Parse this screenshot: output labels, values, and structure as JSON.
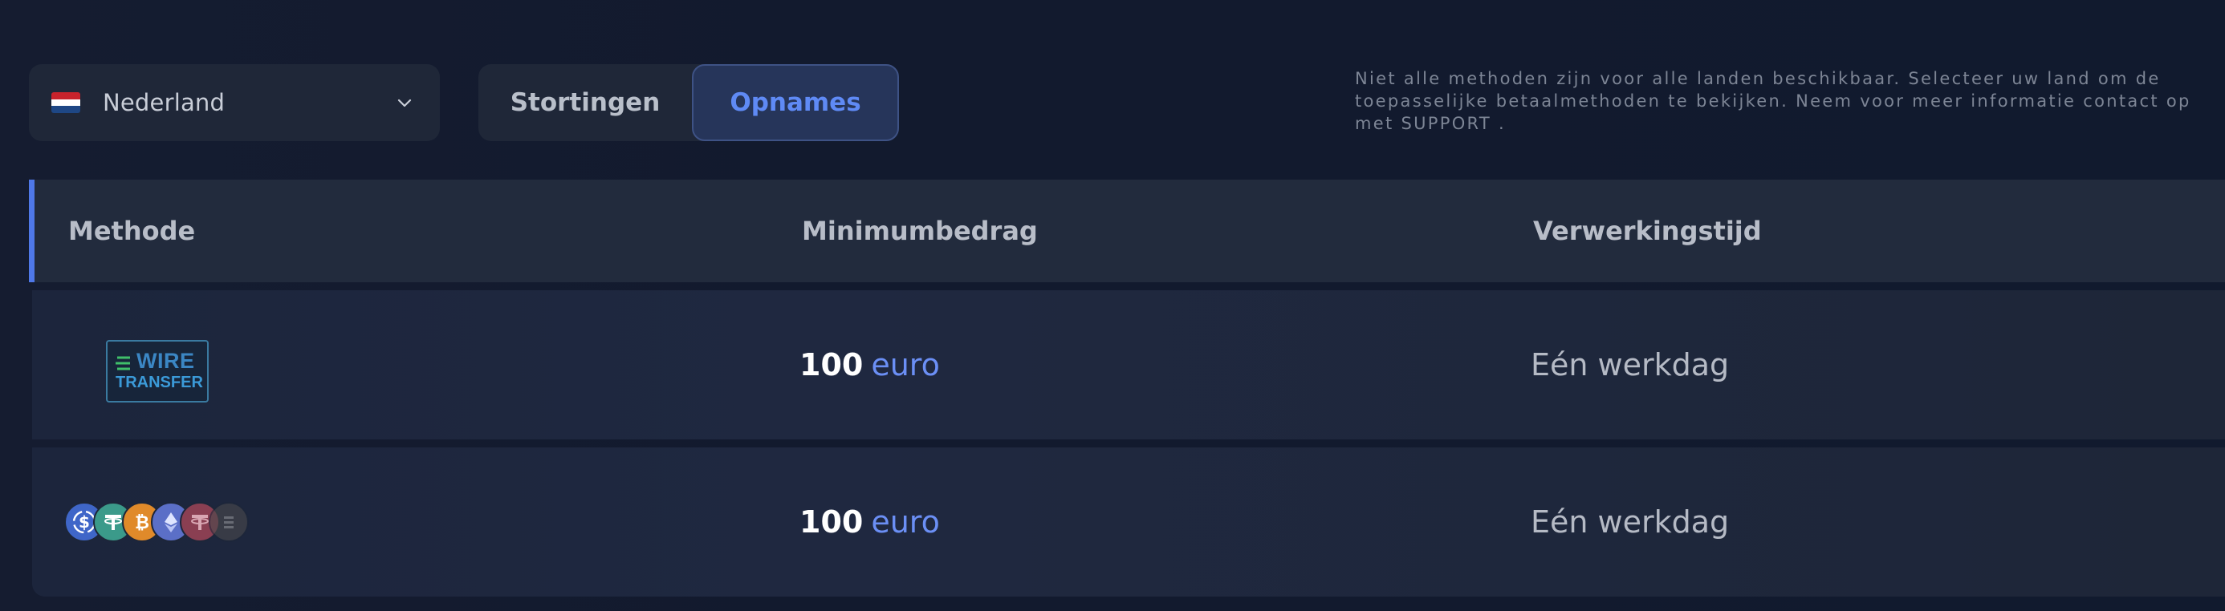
{
  "country_select": {
    "label": "Nederland",
    "flag_icon": "netherlands-flag-icon",
    "chevron_icon": "chevron-down-icon"
  },
  "tabs": {
    "stortingen": "Stortingen",
    "opnames": "Opnames",
    "active": "Opnames",
    "active_color": "#5f8af5"
  },
  "info": {
    "line1": "Niet alle methoden zijn voor alle landen beschikbaar. Selecteer uw land om de",
    "line2": "toepasselijke betaalmethoden te bekijken. Neem voor meer informatie contact op",
    "line3": "met SUPPORT ."
  },
  "table": {
    "headers": {
      "method": "Methode",
      "min": "Minimumbedrag",
      "time": "Verwerkingstijd"
    },
    "rows": [
      {
        "method_logo": {
          "line1": "WIRE",
          "line2": "TRANSFER"
        },
        "amount": "100",
        "unit": "euro",
        "time": "Eén werkdag"
      },
      {
        "method_icons": [
          "usdc-icon",
          "tether-icon",
          "bitcoin-icon",
          "ethereum-icon",
          "tether-icon",
          "coin-icon"
        ],
        "amount": "100",
        "unit": "euro",
        "time": "Eén werkdag"
      }
    ]
  },
  "colors": {
    "accent": "#4f78e8",
    "background": "#121a2e"
  }
}
